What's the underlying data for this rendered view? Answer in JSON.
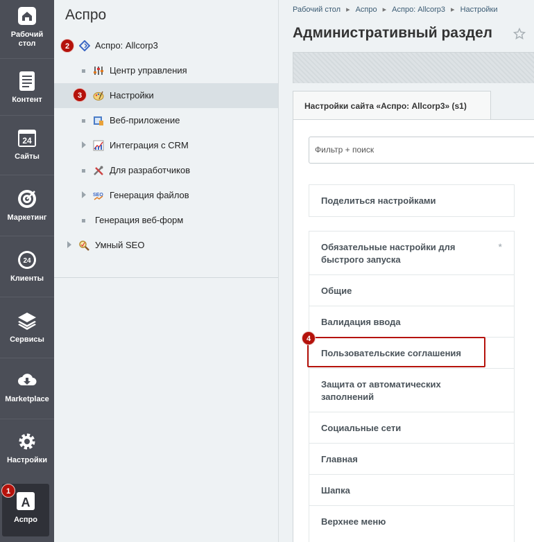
{
  "rail": {
    "items": [
      {
        "label": "Рабочий\nстол",
        "icon": "home-icon"
      },
      {
        "label": "Контент",
        "icon": "document-icon"
      },
      {
        "label": "Сайты",
        "icon": "calendar-24-icon"
      },
      {
        "label": "Маркетинг",
        "icon": "target-icon"
      },
      {
        "label": "Клиенты",
        "icon": "clients-24-icon"
      },
      {
        "label": "Сервисы",
        "icon": "layers-icon"
      },
      {
        "label": "Marketplace",
        "icon": "cloud-download-icon"
      },
      {
        "label": "Настройки",
        "icon": "gear-icon"
      },
      {
        "label": "Аспро",
        "icon": "aspro-a-icon"
      }
    ]
  },
  "menu": {
    "title": "Аспро",
    "items": [
      {
        "label": "Аспро: Allcorp3",
        "icon": "aspro-diamond-icon"
      },
      {
        "label": "Центр управления",
        "icon": "sliders-icon"
      },
      {
        "label": "Настройки",
        "icon": "palette-icon"
      },
      {
        "label": "Веб-приложение",
        "icon": "web-app-icon"
      },
      {
        "label": "Интеграция с CRM",
        "icon": "chart-icon"
      },
      {
        "label": "Для разработчиков",
        "icon": "tools-icon"
      },
      {
        "label": "Генерация файлов",
        "icon": "seo-icon"
      },
      {
        "label": "Генерация веб-форм",
        "icon": ""
      },
      {
        "label": "Умный SEO",
        "icon": "magnifier-icon"
      }
    ]
  },
  "badges": [
    "1",
    "2",
    "3",
    "4"
  ],
  "breadcrumbs": [
    "Рабочий стол",
    "Аспро",
    "Аспро: Allcorp3",
    "Настройки"
  ],
  "page_title": "Административный раздел",
  "tab_label": "Настройки сайта «Аспро: Allcorp3» (s1)",
  "filter": {
    "placeholder": "Фильтр + поиск"
  },
  "share_label": "Поделиться настройками",
  "sections": [
    {
      "label": "Обязательные настройки для быстрого запуска",
      "required_mark": "*"
    },
    {
      "label": "Общие"
    },
    {
      "label": "Валидация ввода"
    },
    {
      "label": "Пользовательские соглашения"
    },
    {
      "label": "Защита от автоматических заполнений"
    },
    {
      "label": "Социальные сети"
    },
    {
      "label": "Главная"
    },
    {
      "label": "Шапка"
    },
    {
      "label": "Верхнее меню"
    }
  ],
  "colors": {
    "rail": "#4b4e57",
    "badge": "#b5120b",
    "link": "#3b5b73"
  }
}
